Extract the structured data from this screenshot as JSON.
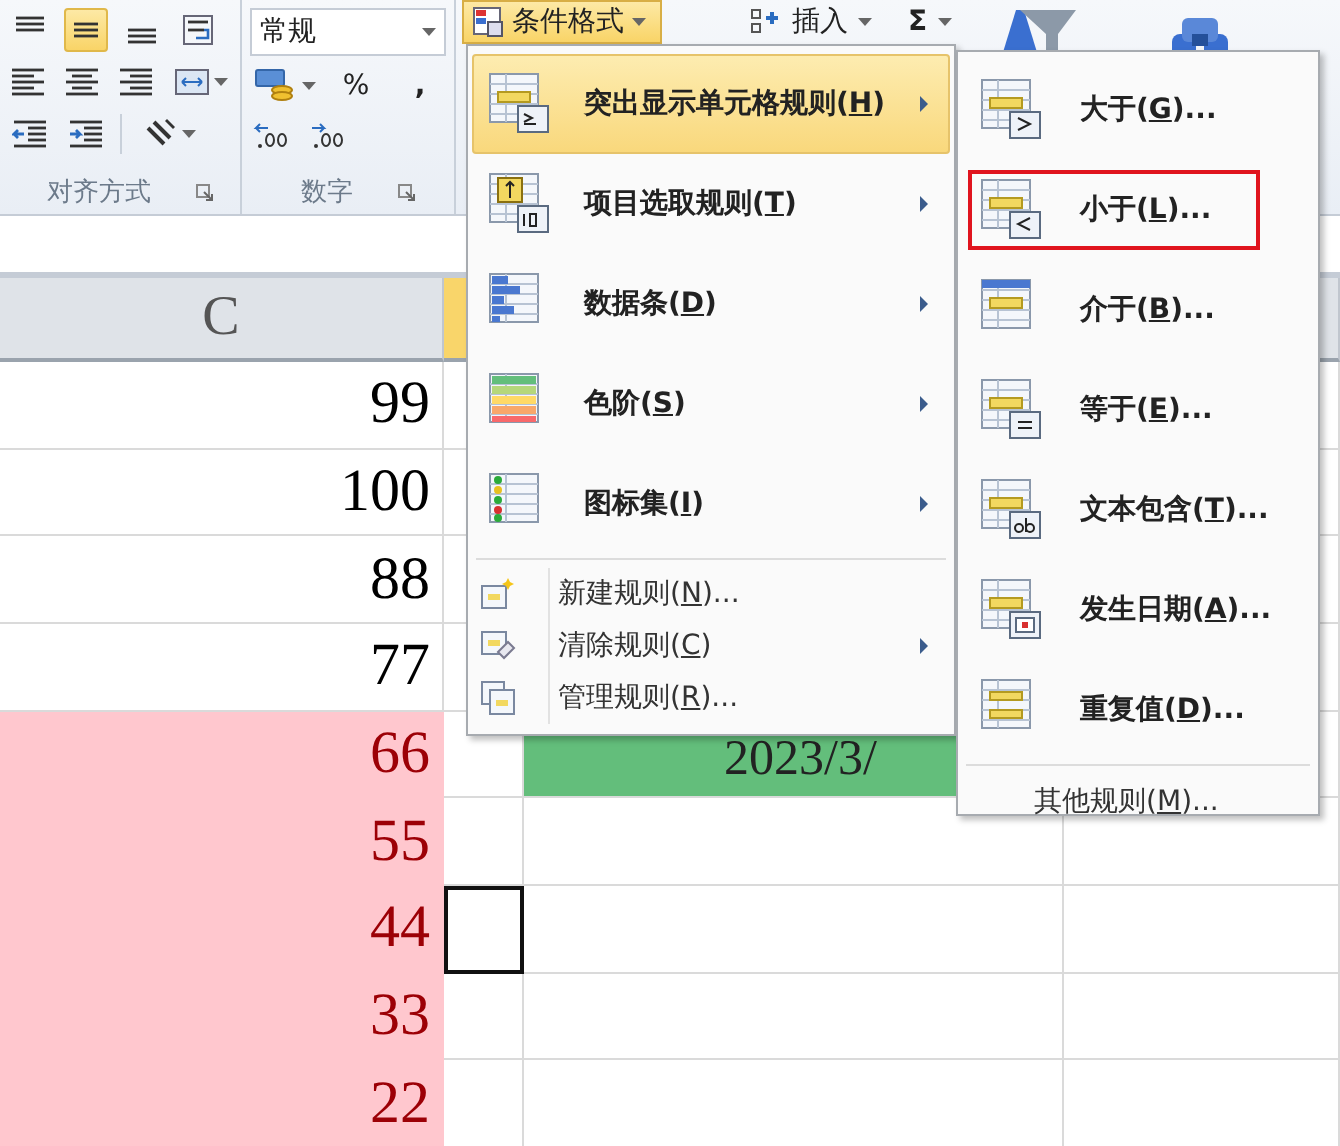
{
  "ribbon": {
    "alignment": {
      "label": "对齐方式",
      "rows": [
        [
          {
            "kind": "align-top",
            "selected": false
          },
          {
            "kind": "align-middle",
            "selected": true
          },
          {
            "kind": "align-bottom",
            "selected": false
          },
          {
            "kind": "wrap",
            "selected": false
          }
        ],
        [
          {
            "kind": "align-left",
            "selected": false
          },
          {
            "kind": "align-center",
            "selected": false
          },
          {
            "kind": "align-right",
            "selected": false
          },
          {
            "kind": "merge",
            "selected": false
          }
        ],
        [
          {
            "kind": "indent-less",
            "selected": false
          },
          {
            "kind": "indent-more",
            "selected": false
          },
          {
            "kind": "orientation",
            "selected": false
          }
        ]
      ]
    },
    "number": {
      "label": "数字",
      "format": "常规",
      "percent": "%",
      "comma": ","
    },
    "conditional_format": {
      "label": "条件格式",
      "open": true
    },
    "insert": {
      "label": "插入"
    },
    "sum": {
      "label": "Σ"
    }
  },
  "sheet": {
    "column_header": "C",
    "rows": [
      {
        "c": "99",
        "c_highlighted": false,
        "d_active": false
      },
      {
        "c": "100",
        "c_highlighted": false,
        "d_active": false
      },
      {
        "c": "88",
        "c_highlighted": false,
        "d_active": false
      },
      {
        "c": "77",
        "c_highlighted": false,
        "d_active": false
      },
      {
        "c": "66",
        "c_highlighted": true,
        "d_active": false,
        "e": "2023/3/",
        "e_highlighted": true
      },
      {
        "c": "55",
        "c_highlighted": true,
        "d_active": false
      },
      {
        "c": "44",
        "c_highlighted": true,
        "d_active": true
      },
      {
        "c": "33",
        "c_highlighted": true,
        "d_active": false
      },
      {
        "c": "22",
        "c_highlighted": true,
        "d_active": false
      }
    ]
  },
  "menu": {
    "items": [
      {
        "kind": "large",
        "text": "突出显示单元格规则(",
        "key": "H",
        "tail": ")",
        "submenu": true,
        "selected": true
      },
      {
        "kind": "large",
        "text": "项目选取规则(",
        "key": "T",
        "tail": ")",
        "submenu": true,
        "selected": false
      },
      {
        "kind": "large",
        "text": "数据条(",
        "key": "D",
        "tail": ")",
        "submenu": true,
        "selected": false
      },
      {
        "kind": "large",
        "text": "色阶(",
        "key": "S",
        "tail": ")",
        "submenu": true,
        "selected": false
      },
      {
        "kind": "large",
        "text": "图标集(",
        "key": "I",
        "tail": ")",
        "submenu": true,
        "selected": false
      },
      {
        "kind": "small",
        "text": "新建规则(",
        "key": "N",
        "tail": ")...",
        "submenu": false,
        "selected": false
      },
      {
        "kind": "small",
        "text": "清除规则(",
        "key": "C",
        "tail": ")",
        "submenu": true,
        "selected": false
      },
      {
        "kind": "small",
        "text": "管理规则(",
        "key": "R",
        "tail": ")...",
        "submenu": false,
        "selected": false
      }
    ]
  },
  "submenu": {
    "items": [
      {
        "kind": "large",
        "text": "大于(",
        "key": "G",
        "tail": ")...",
        "annotated": false
      },
      {
        "kind": "large",
        "text": "小于(",
        "key": "L",
        "tail": ")...",
        "annotated": true
      },
      {
        "kind": "large",
        "text": "介于(",
        "key": "B",
        "tail": ")...",
        "annotated": false
      },
      {
        "kind": "large",
        "text": "等于(",
        "key": "E",
        "tail": ")...",
        "annotated": false
      },
      {
        "kind": "large",
        "text": "文本包含(",
        "key": "T",
        "tail": ")...",
        "annotated": false
      },
      {
        "kind": "large",
        "text": "发生日期(",
        "key": "A",
        "tail": ")...",
        "annotated": false
      },
      {
        "kind": "large",
        "text": "重复值(",
        "key": "D",
        "tail": ")...",
        "annotated": false
      },
      {
        "kind": "small",
        "text": "其他规则(",
        "key": "M",
        "tail": ")...",
        "annotated": false
      }
    ]
  }
}
